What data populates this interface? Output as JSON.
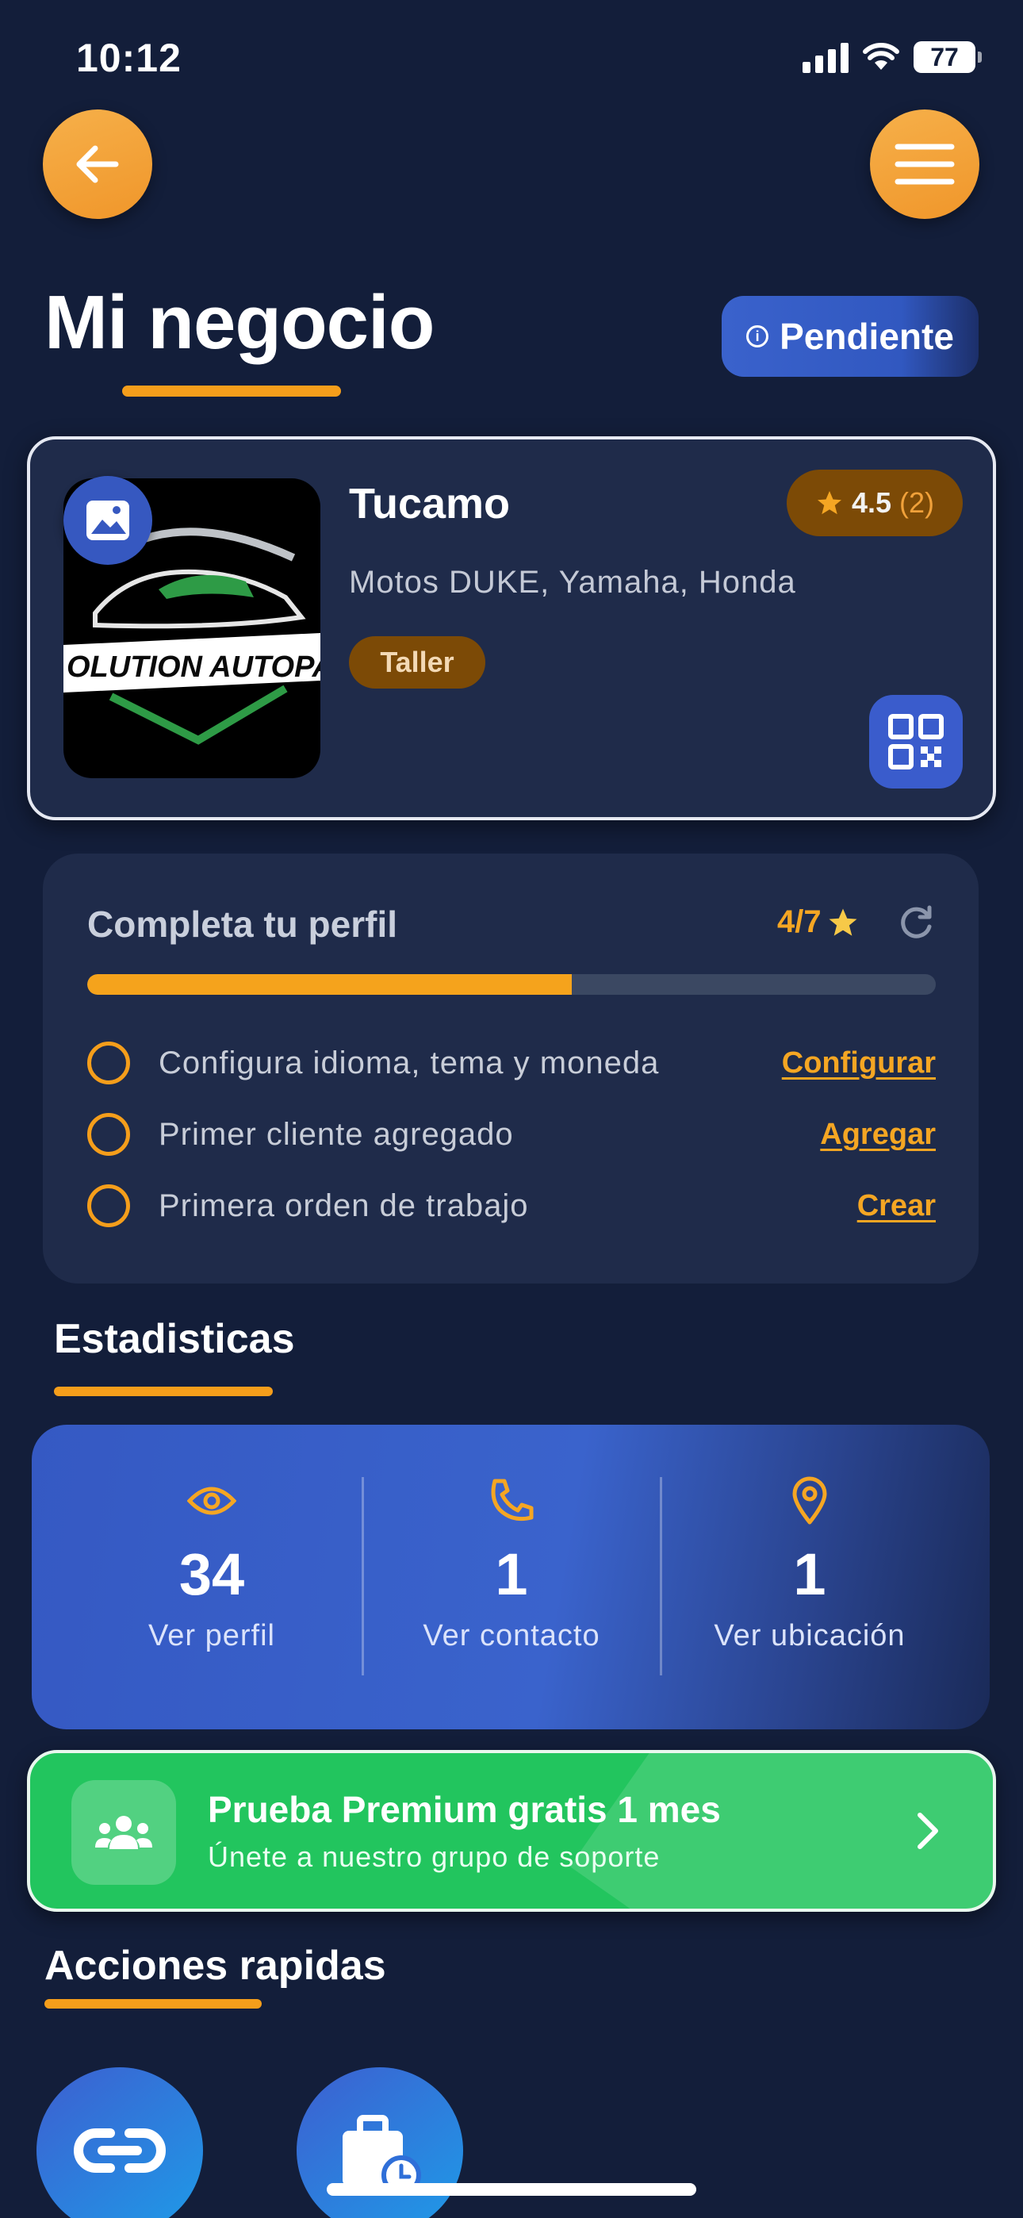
{
  "status_bar": {
    "time": "10:12",
    "battery": "77"
  },
  "header": {
    "title": "Mi negocio",
    "status_badge": "Pendiente"
  },
  "business": {
    "name": "Tucamo",
    "rating": "4.5",
    "rating_count": "(2)",
    "description": "Motos DUKE, Yamaha, Honda",
    "tag": "Taller",
    "logo_text": "OLUTION AUTOPART"
  },
  "profile": {
    "title": "Completa tu perfil",
    "progress_text": "4/7",
    "progress_fraction": 0.5714,
    "tasks": [
      {
        "label": "Configura idioma, tema y moneda",
        "action": "Configurar"
      },
      {
        "label": "Primer cliente agregado",
        "action": "Agregar"
      },
      {
        "label": "Primera orden de trabajo",
        "action": "Crear"
      }
    ]
  },
  "stats": {
    "title": "Estadisticas",
    "items": [
      {
        "icon": "eye-icon",
        "value": "34",
        "label": "Ver perfil"
      },
      {
        "icon": "phone-icon",
        "value": "1",
        "label": "Ver contacto"
      },
      {
        "icon": "location-pin-icon",
        "value": "1",
        "label": "Ver ubicación"
      }
    ]
  },
  "premium": {
    "title": "Prueba Premium gratis 1 mes",
    "subtitle": "Únete a nuestro grupo de soporte"
  },
  "quick_actions": {
    "title": "Acciones rapidas",
    "items": [
      {
        "icon": "link-icon"
      },
      {
        "icon": "briefcase-clock-icon"
      }
    ]
  },
  "colors": {
    "background": "#131e3a",
    "accent_orange": "#f59e1b",
    "card": "#1f2b4a",
    "blue": "#3a5ccc",
    "green": "#22c55e"
  }
}
